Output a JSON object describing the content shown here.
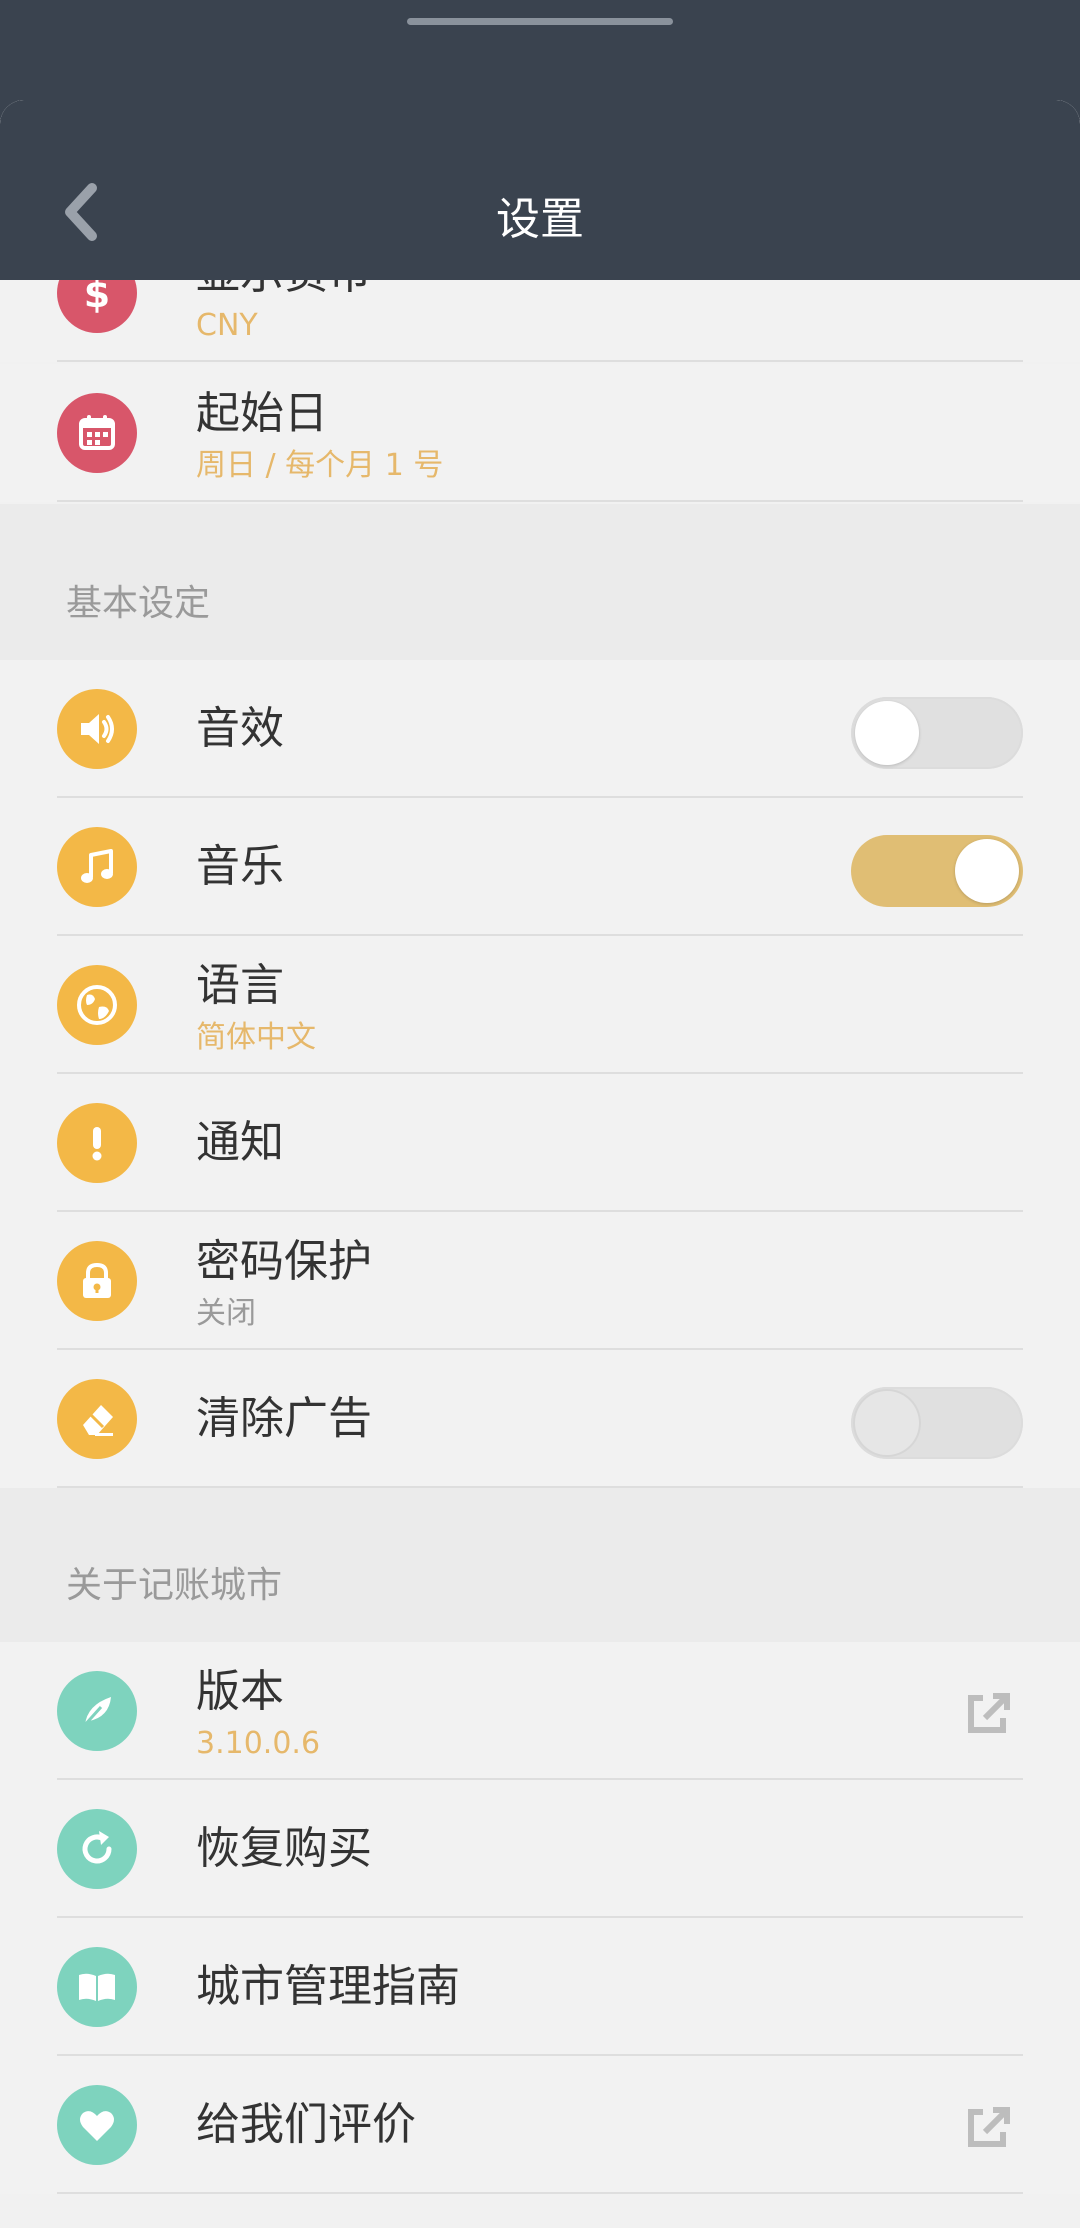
{
  "header": {
    "title": "设置",
    "back_icon": "chevron-left-icon"
  },
  "top_section": {
    "items": [
      {
        "label": "显示货币",
        "value": "CNY",
        "icon": "dollar-icon"
      },
      {
        "label": "起始日",
        "value": "周日 / 每个月 1 号",
        "icon": "calendar-icon"
      }
    ]
  },
  "basic_section": {
    "title": "基本设定",
    "items": [
      {
        "label": "音效",
        "icon": "speaker-icon",
        "toggle": "off"
      },
      {
        "label": "音乐",
        "icon": "music-note-icon",
        "toggle": "on"
      },
      {
        "label": "语言",
        "value": "简体中文",
        "icon": "globe-icon"
      },
      {
        "label": "通知",
        "icon": "exclamation-icon"
      },
      {
        "label": "密码保护",
        "value": "关闭",
        "icon": "lock-icon"
      },
      {
        "label": "清除广告",
        "icon": "eraser-icon",
        "toggle": "off-disabled"
      }
    ]
  },
  "about_section": {
    "title": "关于记账城市",
    "items": [
      {
        "label": "版本",
        "value": "3.10.0.6",
        "icon": "feather-icon",
        "action_icon": "external-link-icon"
      },
      {
        "label": "恢复购买",
        "icon": "restore-icon"
      },
      {
        "label": "城市管理指南",
        "icon": "book-icon"
      },
      {
        "label": "给我们评价",
        "icon": "heart-icon",
        "action_icon": "external-link-icon"
      }
    ]
  },
  "colors": {
    "header_bg": "#3a434f",
    "accent_gold": "#e6b86b",
    "icon_red": "#d8566a",
    "icon_yellow": "#f3b847",
    "icon_teal": "#7ed3be"
  }
}
